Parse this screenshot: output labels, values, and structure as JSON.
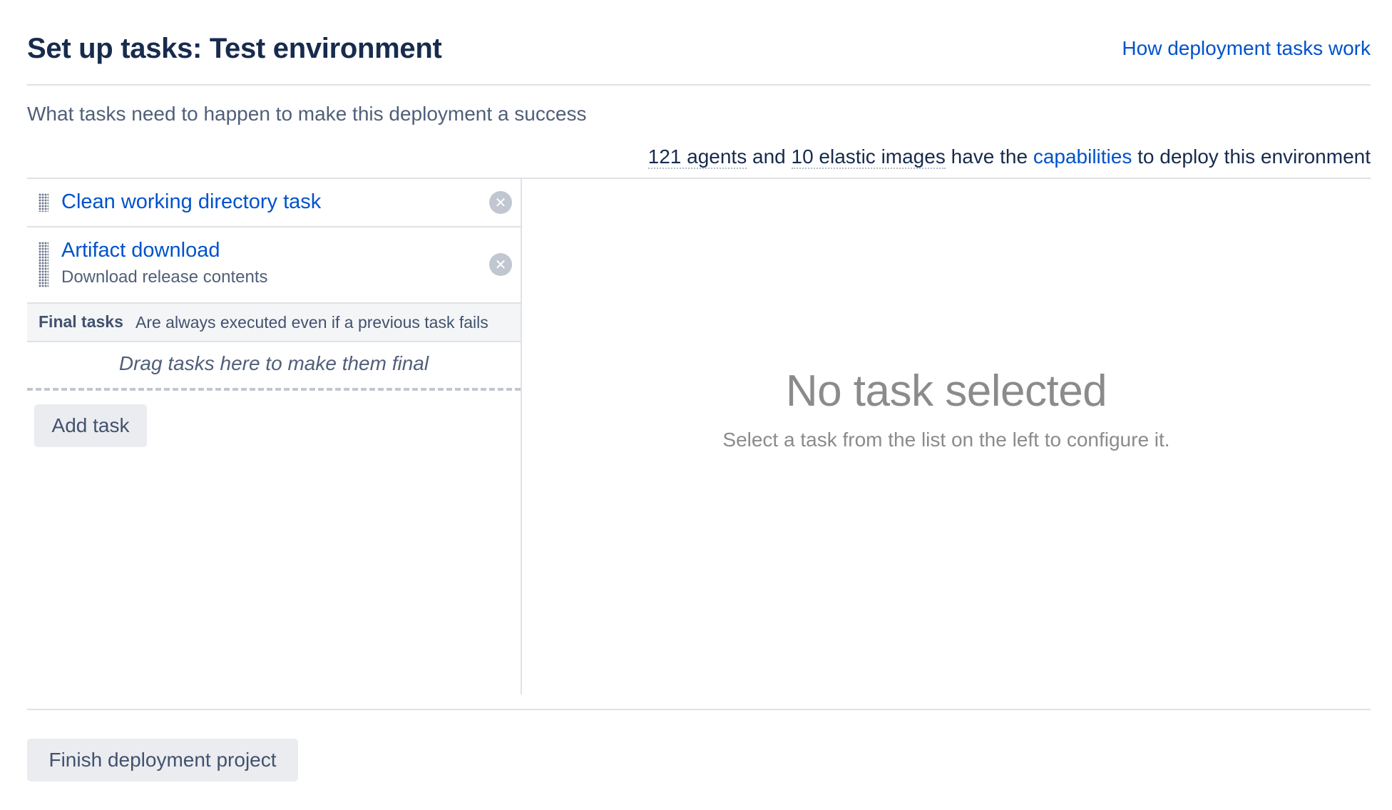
{
  "header": {
    "title": "Set up tasks: Test environment",
    "help_link": "How deployment tasks work"
  },
  "description": "What tasks need to happen to make this deployment a success",
  "capabilities": {
    "agents": "121 agents",
    "and": "and",
    "images": "10 elastic images",
    "have_the": "have the",
    "link": "capabilities",
    "suffix": "to deploy this environment"
  },
  "tasks": [
    {
      "name": "Clean working directory task",
      "description": ""
    },
    {
      "name": "Artifact download",
      "description": "Download release contents"
    }
  ],
  "final_tasks": {
    "label": "Final tasks",
    "note": "Are always executed even if a previous task fails",
    "drop_hint": "Drag tasks here to make them final"
  },
  "buttons": {
    "add_task": "Add task",
    "finish": "Finish deployment project"
  },
  "empty_state": {
    "title": "No task selected",
    "hint": "Select a task from the list on the left to configure it."
  },
  "icons": {
    "remove": "close-circle-icon",
    "drag": "drag-handle-icon"
  },
  "colors": {
    "link": "#0052cc",
    "text": "#172b4d",
    "muted": "#8b8b8b",
    "button_bg": "#ebecf0"
  }
}
